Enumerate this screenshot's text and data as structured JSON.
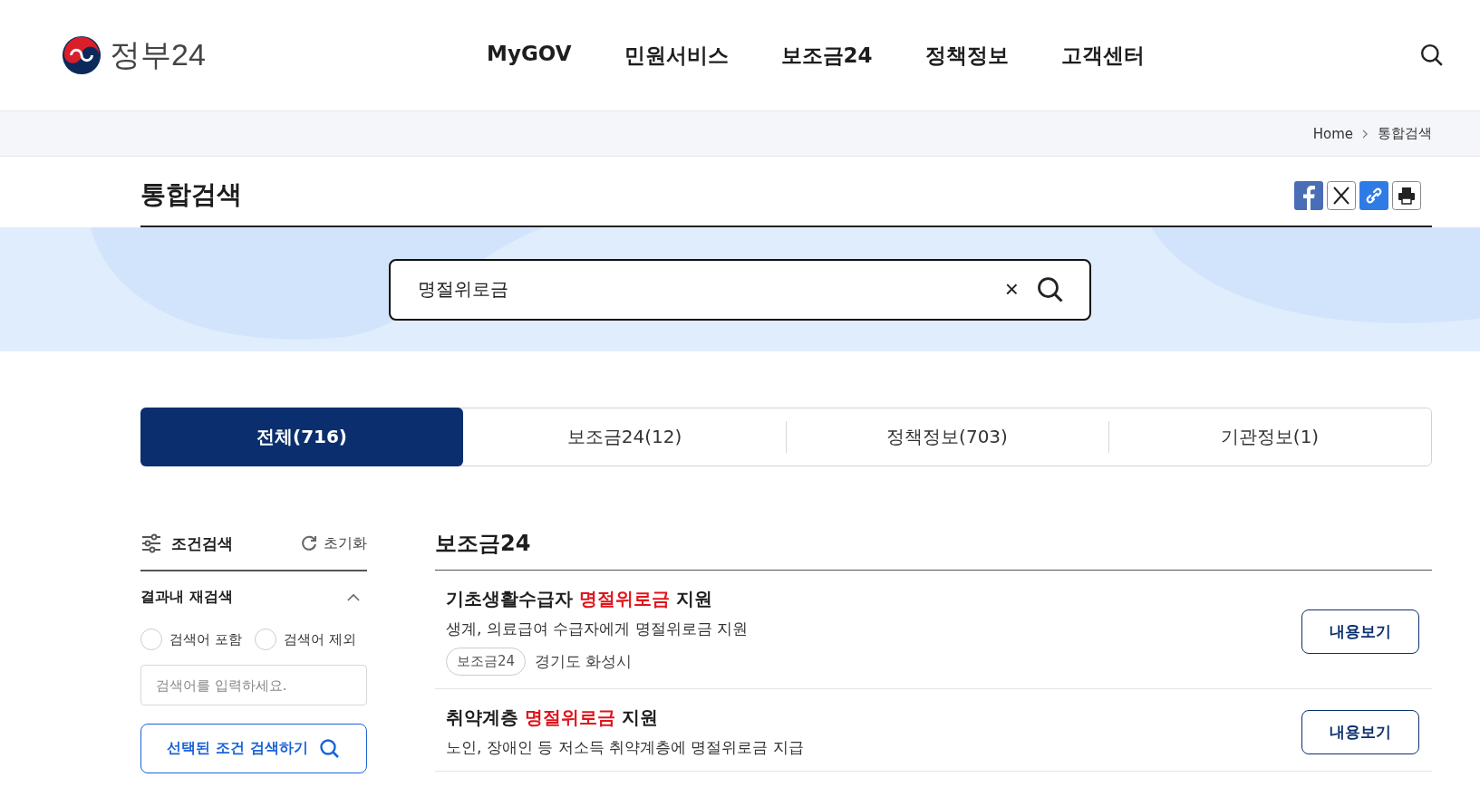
{
  "header": {
    "logo_text": "정부24",
    "nav": [
      {
        "label": "MyGOV"
      },
      {
        "label": "민원서비스"
      },
      {
        "label": "보조금24"
      },
      {
        "label": "정책정보"
      },
      {
        "label": "고객센터"
      }
    ]
  },
  "breadcrumb": [
    "Home",
    "통합검색"
  ],
  "page_title": "통합검색",
  "search": {
    "value": "명절위로금",
    "clear_label": "×"
  },
  "tabs": [
    {
      "label": "전체(716)",
      "selected": true
    },
    {
      "label": "보조금24(12)",
      "selected": false
    },
    {
      "label": "정책정보(703)",
      "selected": false
    },
    {
      "label": "기관정보(1)",
      "selected": false
    }
  ],
  "filter": {
    "title": "조건검색",
    "reset": "초기화",
    "section": "결과내 재검색",
    "expanded": true,
    "options": [
      {
        "label": "검색어 포함",
        "selected": false
      },
      {
        "label": "검색어 제외",
        "selected": false
      }
    ],
    "placeholder": "검색어를 입력하세요.",
    "submit": "선택된 조건 검색하기"
  },
  "results": {
    "heading": "보조금24",
    "items": [
      {
        "title": [
          {
            "text": "기초생활수급자 ",
            "highlight": false
          },
          {
            "text": "명절위로금",
            "highlight": true
          },
          {
            "text": " 지원",
            "highlight": false
          }
        ],
        "description": "생계, 의료급여 수급자에게 명절위로금 지원",
        "tag": "보조금24",
        "agency": "경기도 화성시",
        "button": "내용보기"
      },
      {
        "title": [
          {
            "text": "취약계층 ",
            "highlight": false
          },
          {
            "text": "명절위로금",
            "highlight": true
          },
          {
            "text": " 지원",
            "highlight": false
          }
        ],
        "description": "노인, 장애인 등 저소득 취약계층에 명절위로금 지급",
        "button": "내용보기"
      }
    ]
  }
}
